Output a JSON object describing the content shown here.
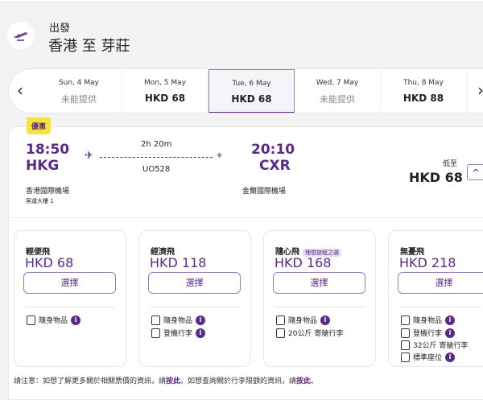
{
  "header": {
    "subtitle": "出發",
    "title": "香港 至 芽莊"
  },
  "dates": [
    {
      "date": "Sun, 4 May",
      "price": "未能提供",
      "available": false
    },
    {
      "date": "Mon, 5 May",
      "price": "HKD 68",
      "available": true
    },
    {
      "date": "Tue, 6 May",
      "price": "HKD 68",
      "available": true,
      "selected": true
    },
    {
      "date": "Wed, 7 May",
      "price": "未能提供",
      "available": false
    },
    {
      "date": "Thu, 8 May",
      "price": "HKD 88",
      "available": true
    }
  ],
  "flight": {
    "badge": "優惠",
    "dep_time": "18:50",
    "dep_code": "HKG",
    "dep_airport": "香港國際機場",
    "dep_terminal": "客運大樓 1",
    "duration": "2h 20m",
    "flight_no": "UO528",
    "arr_time": "20:10",
    "arr_code": "CXR",
    "arr_airport": "金蘭國際機場",
    "from_label": "低至",
    "from_price": "HKD 68"
  },
  "fares": [
    {
      "name": "輕便飛",
      "price": "HKD 68",
      "button": "選擇",
      "features": [
        {
          "text": "隨身物品",
          "info": true
        }
      ]
    },
    {
      "name": "經濟飛",
      "price": "HKD 118",
      "button": "選擇",
      "features": [
        {
          "text": "隨身物品",
          "info": true
        },
        {
          "text": "登機行李",
          "info": true
        }
      ]
    },
    {
      "name": "隨心飛",
      "tag": "理想旅程之選",
      "price": "HKD 168",
      "button": "選擇",
      "features": [
        {
          "text": "隨身物品",
          "info": true
        },
        {
          "text": "20公斤 寄艙行李",
          "info": false
        }
      ]
    },
    {
      "name": "無憂飛",
      "price": "HKD 218",
      "button": "選擇",
      "features": [
        {
          "text": "隨身物品",
          "info": true
        },
        {
          "text": "登機行李",
          "info": true
        },
        {
          "text": "32公斤 寄艙行李",
          "info": false
        },
        {
          "text": "標準座位",
          "info": true
        }
      ]
    }
  ],
  "note": {
    "part1": "請注意：如想了解更多關於相關票價的資訊，請",
    "link1": "按此",
    "part2": "。如想查詢關於行李限額的資訊，請",
    "link2": "按此",
    "part3": "。"
  },
  "colors": {
    "brand": "#5b2a86",
    "badge": "#f7e43a"
  }
}
